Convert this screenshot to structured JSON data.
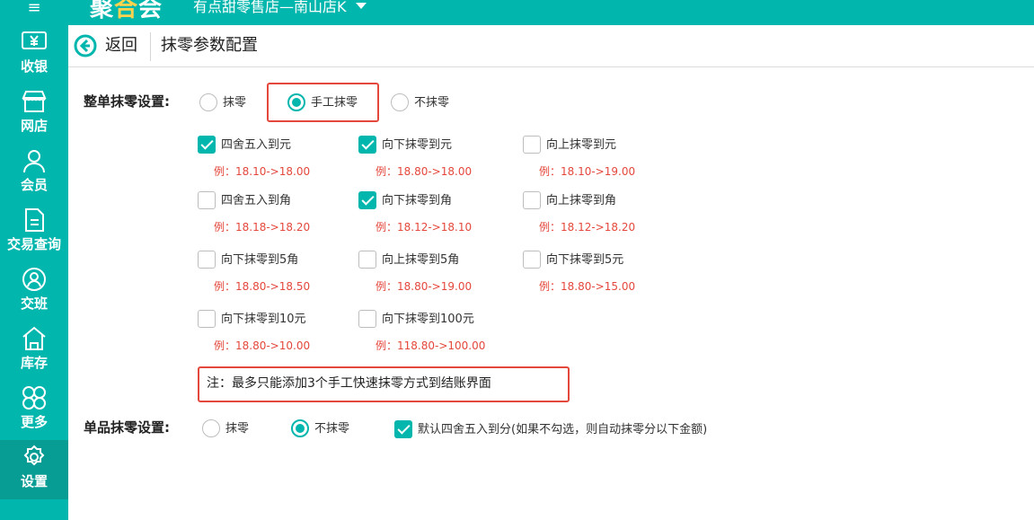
{
  "topbar": {
    "menu_glyph": "≡",
    "logo_part1": "聚",
    "logo_part2": "合",
    "logo_part3": "会",
    "store_name": "有点甜零售店—南山店K"
  },
  "sidebar": {
    "items": [
      {
        "label": "收银",
        "icon": "cashier-yen-icon"
      },
      {
        "label": "网店",
        "icon": "shop-icon"
      },
      {
        "label": "会员",
        "icon": "member-person-icon"
      },
      {
        "label": "交易查询",
        "icon": "document-icon"
      },
      {
        "label": "交班",
        "icon": "shift-handover-icon"
      },
      {
        "label": "库存",
        "icon": "warehouse-icon"
      },
      {
        "label": "更多",
        "icon": "more-clover-icon"
      },
      {
        "label": "设置",
        "icon": "gear-icon",
        "active": true
      }
    ]
  },
  "header": {
    "back_label": "返回",
    "title": "抹零参数配置"
  },
  "whole_order": {
    "label": "整单抹零设置:",
    "options": [
      {
        "label": "抹零",
        "selected": false
      },
      {
        "label": "手工抹零",
        "selected": true
      },
      {
        "label": "不抹零",
        "selected": false
      }
    ],
    "rules": [
      {
        "label": "四舍五入到元",
        "example": "例：18.10->18.00",
        "checked": true
      },
      {
        "label": "向下抹零到元",
        "example": "例：18.80->18.00",
        "checked": true
      },
      {
        "label": "向上抹零到元",
        "example": "例：18.10->19.00",
        "checked": false
      },
      {
        "label": "四舍五入到角",
        "example": "例：18.18->18.20",
        "checked": false
      },
      {
        "label": "向下抹零到角",
        "example": "例：18.12->18.10",
        "checked": true
      },
      {
        "label": "向上抹零到角",
        "example": "例：18.12->18.20",
        "checked": false
      },
      {
        "label": "向下抹零到5角",
        "example": "例：18.80->18.50",
        "checked": false
      },
      {
        "label": "向上抹零到5角",
        "example": "例：18.80->19.00",
        "checked": false
      },
      {
        "label": "向下抹零到5元",
        "example": "例：18.80->15.00",
        "checked": false
      },
      {
        "label": "向下抹零到10元",
        "example": "例：18.80->10.00",
        "checked": false
      },
      {
        "label": "向下抹零到100元",
        "example": "例：118.80->100.00",
        "checked": false
      }
    ],
    "note": "注：最多只能添加3个手工快速抹零方式到结账界面"
  },
  "single_item": {
    "label": "单品抹零设置:",
    "options": [
      {
        "label": "抹零",
        "selected": false
      },
      {
        "label": "不抹零",
        "selected": true
      }
    ],
    "default_round": {
      "label": "默认四舍五入到分(如果不勾选，则自动抹零分以下金额)",
      "checked": true
    }
  },
  "colors": {
    "accent": "#00b6ad",
    "sidebar_active": "#079c94",
    "highlight": "#e4473b",
    "example_text": "#e4473b"
  }
}
